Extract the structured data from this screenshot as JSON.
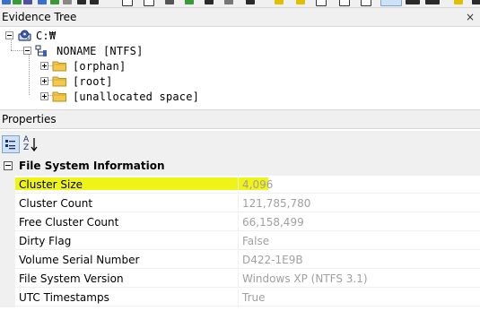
{
  "evidence_tree": {
    "title": "Evidence Tree",
    "close": "×",
    "nodes": [
      {
        "label": "C:₩",
        "icon": "drive-icon"
      },
      {
        "label": "NONAME [NTFS]",
        "icon": "filesystem-icon"
      },
      {
        "label": "[orphan]",
        "icon": "folder-icon"
      },
      {
        "label": "[root]",
        "icon": "folder-icon"
      },
      {
        "label": "[unallocated space]",
        "icon": "folder-icon"
      }
    ]
  },
  "properties": {
    "title": "Properties",
    "toolbar": {
      "categorized_icon": "categorized-view-icon",
      "alphabetical_icon": "sort-az-icon",
      "sort_label_a": "A",
      "sort_label_z": "Z"
    },
    "category": "File System Information",
    "rows": [
      {
        "name": "Cluster Size",
        "value": "4,096"
      },
      {
        "name": "Cluster Count",
        "value": "121,785,780"
      },
      {
        "name": "Free Cluster Count",
        "value": "66,158,499"
      },
      {
        "name": "Dirty Flag",
        "value": "False"
      },
      {
        "name": "Volume Serial Number",
        "value": "D422-1E9B"
      },
      {
        "name": "File System Version",
        "value": "Windows XP (NTFS 3.1)"
      },
      {
        "name": "UTC Timestamps",
        "value": "True"
      }
    ]
  },
  "colors": {
    "highlight": "#eef30a",
    "panel_bg": "#f0f0f0",
    "value_text": "#a0a0a0",
    "folder": "#f2c94c",
    "selected_button": "#cde1f7"
  }
}
